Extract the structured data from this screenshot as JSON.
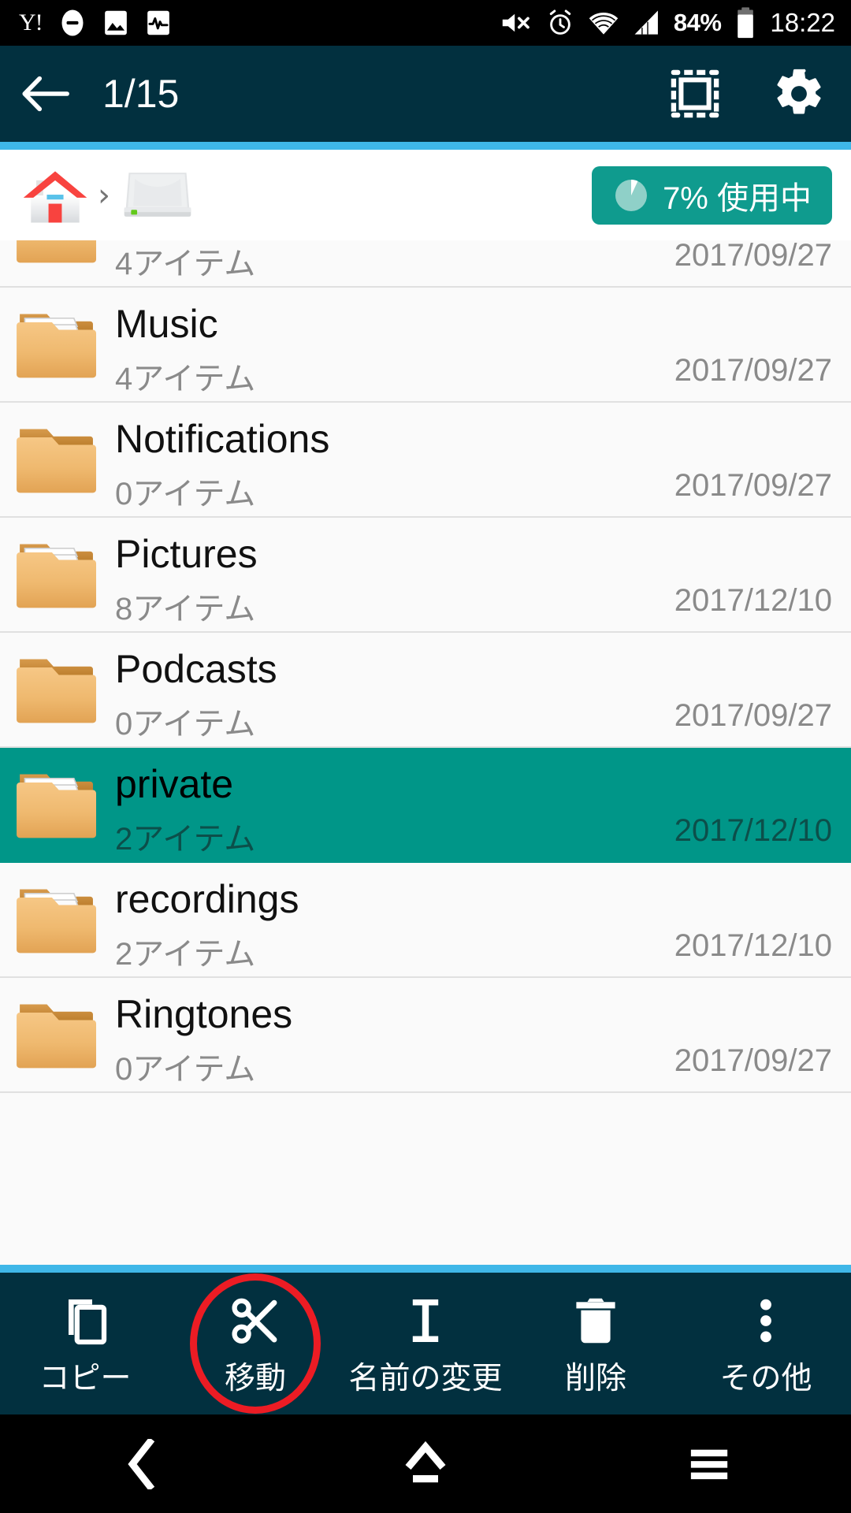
{
  "statusbar": {
    "left_icons": [
      "yahoo-icon",
      "do-not-disturb-icon",
      "image-icon",
      "activity-icon"
    ],
    "yahoo_label": "Y!",
    "right_icons": [
      "volume-mute-icon",
      "alarm-icon",
      "wifi-icon",
      "signal-icon"
    ],
    "battery_percent": "84%",
    "clock": "18:22"
  },
  "appbar": {
    "back_icon": "back-arrow-icon",
    "title": "1/15",
    "select_all_icon": "select-all-icon",
    "settings_icon": "gear-icon",
    "bg_color": "#02303f",
    "accent_color": "#3fb7e8"
  },
  "breadcrumb": {
    "items": [
      {
        "icon": "home-icon",
        "label": ""
      },
      {
        "icon": "hard-drive-icon",
        "label": ""
      }
    ],
    "separator": "›",
    "usage": {
      "icon": "pie-chart-icon",
      "text": "7% 使用中",
      "percent": 7,
      "color": "#0f9b8e"
    }
  },
  "file_list": {
    "rows": [
      {
        "name": "",
        "sub": "4アイテム",
        "date": "2017/09/27",
        "icon": "folder-icon",
        "has_items": false,
        "selected": false,
        "partial": true
      },
      {
        "name": "Music",
        "sub": "4アイテム",
        "date": "2017/09/27",
        "icon": "folder-full-icon",
        "has_items": true,
        "selected": false,
        "partial": false
      },
      {
        "name": "Notifications",
        "sub": "0アイテム",
        "date": "2017/09/27",
        "icon": "folder-icon",
        "has_items": false,
        "selected": false,
        "partial": false
      },
      {
        "name": "Pictures",
        "sub": "8アイテム",
        "date": "2017/12/10",
        "icon": "folder-full-icon",
        "has_items": true,
        "selected": false,
        "partial": false
      },
      {
        "name": "Podcasts",
        "sub": "0アイテム",
        "date": "2017/09/27",
        "icon": "folder-icon",
        "has_items": false,
        "selected": false,
        "partial": false
      },
      {
        "name": "private",
        "sub": "2アイテム",
        "date": "2017/12/10",
        "icon": "folder-full-icon",
        "has_items": true,
        "selected": true,
        "partial": false
      },
      {
        "name": "recordings",
        "sub": "2アイテム",
        "date": "2017/12/10",
        "icon": "folder-full-icon",
        "has_items": true,
        "selected": false,
        "partial": false
      },
      {
        "name": "Ringtones",
        "sub": "0アイテム",
        "date": "2017/09/27",
        "icon": "folder-icon",
        "has_items": false,
        "selected": false,
        "partial": false
      }
    ],
    "selected_color": "#009688"
  },
  "toolbar": {
    "items": [
      {
        "label": "コピー",
        "icon": "copy-icon",
        "highlighted": false
      },
      {
        "label": "移動",
        "icon": "scissors-icon",
        "highlighted": true
      },
      {
        "label": "名前の変更",
        "icon": "rename-icon",
        "highlighted": false
      },
      {
        "label": "削除",
        "icon": "trash-icon",
        "highlighted": false
      },
      {
        "label": "その他",
        "icon": "more-vertical-icon",
        "highlighted": false
      }
    ],
    "highlight_color": "#ec1c24"
  },
  "navbar": {
    "back_icon": "nav-back-icon",
    "home_icon": "nav-home-icon",
    "recents_icon": "nav-recents-icon"
  }
}
